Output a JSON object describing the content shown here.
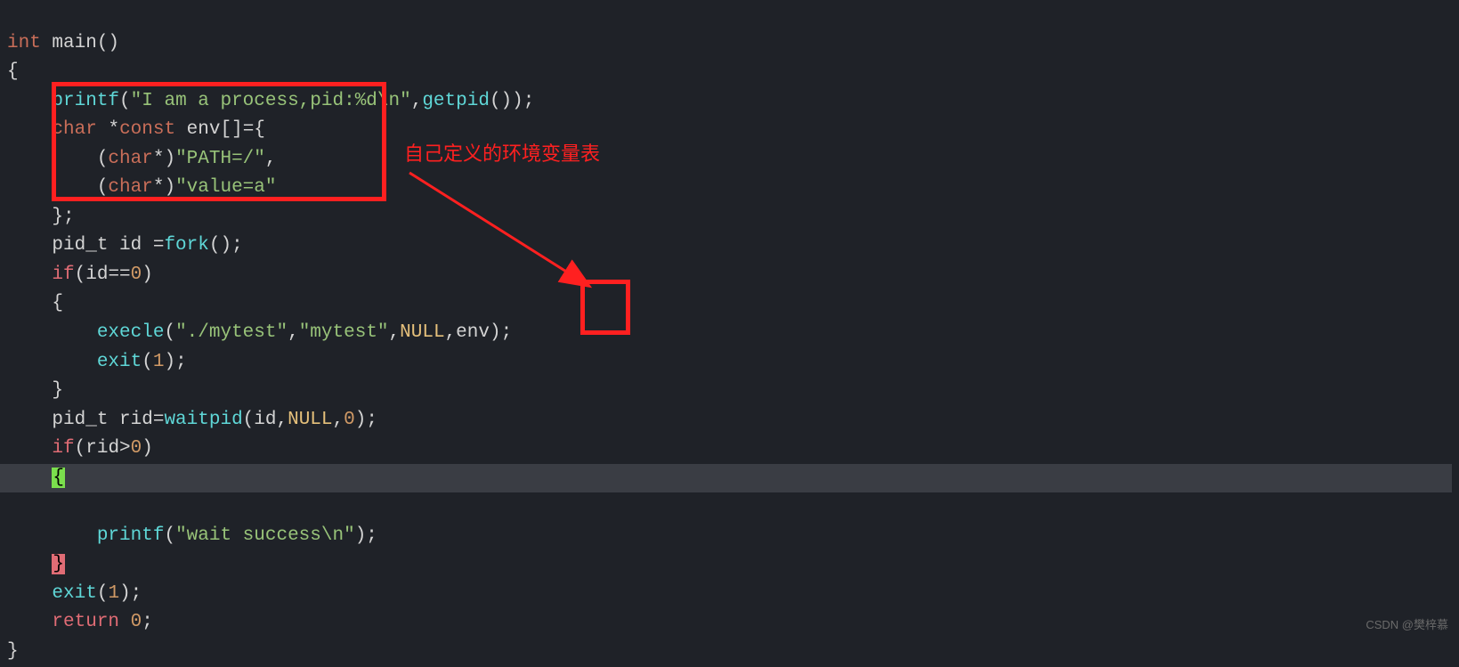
{
  "code": {
    "line1_int": "int",
    "line1_main": " main",
    "line1_paren": "()",
    "line2": "{",
    "line3_ind": "    ",
    "line3_printf": "printf",
    "line3_paren1": "(",
    "line3_str": "\"I am a process,pid:%d\\n\"",
    "line3_comma": ",",
    "line3_getpid": "getpid",
    "line3_paren2": "());",
    "line4_ind": "    ",
    "line4_char": "char",
    "line4_star": " *",
    "line4_const": "const",
    "line4_rest": " env[]={",
    "line5_ind": "        (",
    "line5_char": "char",
    "line5_star": "*)",
    "line5_str": "\"PATH=/\"",
    "line5_comma": ",",
    "line6_ind": "        (",
    "line6_char": "char",
    "line6_star": "*)",
    "line6_str": "\"value=a\"",
    "line7": "    };",
    "line8_ind": "    ",
    "line8_pid": "pid_t id =",
    "line8_fork": "fork",
    "line8_paren": "();",
    "line9_ind": "    ",
    "line9_if": "if",
    "line9_cond": "(id==",
    "line9_zero": "0",
    "line9_close": ")",
    "line10": "    {",
    "line11_ind": "        ",
    "line11_execle": "execle",
    "line11_paren1": "(",
    "line11_str1": "\"./mytest\"",
    "line11_comma1": ",",
    "line11_str2": "\"mytest\"",
    "line11_comma2": ",",
    "line11_null": "NULL",
    "line11_comma3": ",",
    "line11_env": "env",
    "line11_close": ");",
    "line12_ind": "        ",
    "line12_exit": "exit",
    "line12_paren1": "(",
    "line12_one": "1",
    "line12_close": ");",
    "line13": "    }",
    "line14_ind": "    ",
    "line14_pid": "pid_t rid=",
    "line14_waitpid": "waitpid",
    "line14_paren": "(id,",
    "line14_null": "NULL",
    "line14_comma": ",",
    "line14_zero": "0",
    "line14_close": ");",
    "line15_ind": "    ",
    "line15_if": "if",
    "line15_cond": "(rid>",
    "line15_zero": "0",
    "line15_close": ")",
    "line16_ind": "    ",
    "line16_brace": "{",
    "line17_ind": "        ",
    "line17_printf": "printf",
    "line17_paren1": "(",
    "line17_str": "\"wait success\\n\"",
    "line17_close": ");",
    "line18_ind": "    ",
    "line18_brace": "}",
    "line19_ind": "    ",
    "line19_exit": "exit",
    "line19_paren1": "(",
    "line19_one": "1",
    "line19_close": ");",
    "line20_ind": "    ",
    "line20_return": "return",
    "line20_space": " ",
    "line20_zero": "0",
    "line20_semi": ";",
    "line21": "}"
  },
  "annotation": "自己定义的环境变量表",
  "watermark": "CSDN @樊梓慕"
}
